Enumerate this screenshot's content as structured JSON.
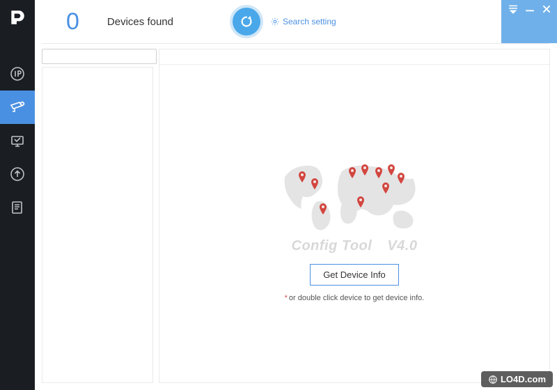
{
  "header": {
    "device_count": "0",
    "devices_label": "Devices found",
    "search_setting_label": "Search setting"
  },
  "sidebar": {
    "items": [
      {
        "name": "ip",
        "label": "IP"
      },
      {
        "name": "camera",
        "label": "Camera Config"
      },
      {
        "name": "system",
        "label": "System Settings"
      },
      {
        "name": "upgrade",
        "label": "Upgrade"
      },
      {
        "name": "template",
        "label": "Template"
      }
    ],
    "active_index": 1
  },
  "search": {
    "placeholder": "",
    "value": ""
  },
  "content": {
    "tool_name": "Config Tool",
    "tool_version": "V4.0",
    "get_info_button": "Get Device Info",
    "hint_star": "*",
    "hint_text": "or double click device to get device info."
  },
  "watermark": {
    "text": "LO4D.com"
  },
  "colors": {
    "accent": "#4a90e2",
    "sidebar_bg": "#1a1d21",
    "titlebar_bg": "#6fb0ea"
  }
}
